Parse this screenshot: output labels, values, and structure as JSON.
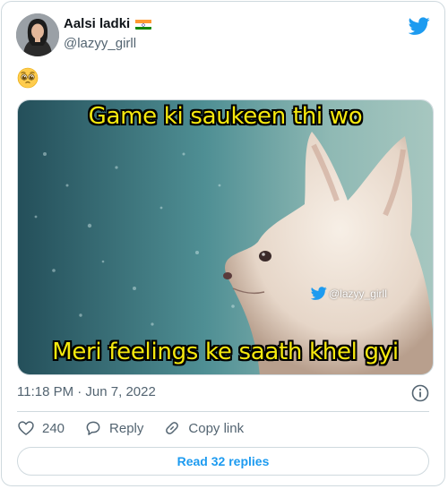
{
  "author": {
    "name": "Aalsi ladki",
    "handle": "@lazyy_girll",
    "flag_icon": "india-flag-icon"
  },
  "tweet": {
    "emoji": "🥺",
    "media": {
      "top_caption": "Game ki saukeen thi wo",
      "bottom_caption": "Meri feelings ke saath khel gyi",
      "watermark": "@lazyy_girll"
    },
    "timestamp": "11:18 PM · Jun 7, 2022"
  },
  "actions": {
    "like_count": "240",
    "reply_label": "Reply",
    "copy_label": "Copy link"
  },
  "read_replies_label": "Read 32 replies",
  "colors": {
    "accent": "#1d9bf0",
    "secondary_text": "#536471",
    "caption": "#f5e80e"
  }
}
